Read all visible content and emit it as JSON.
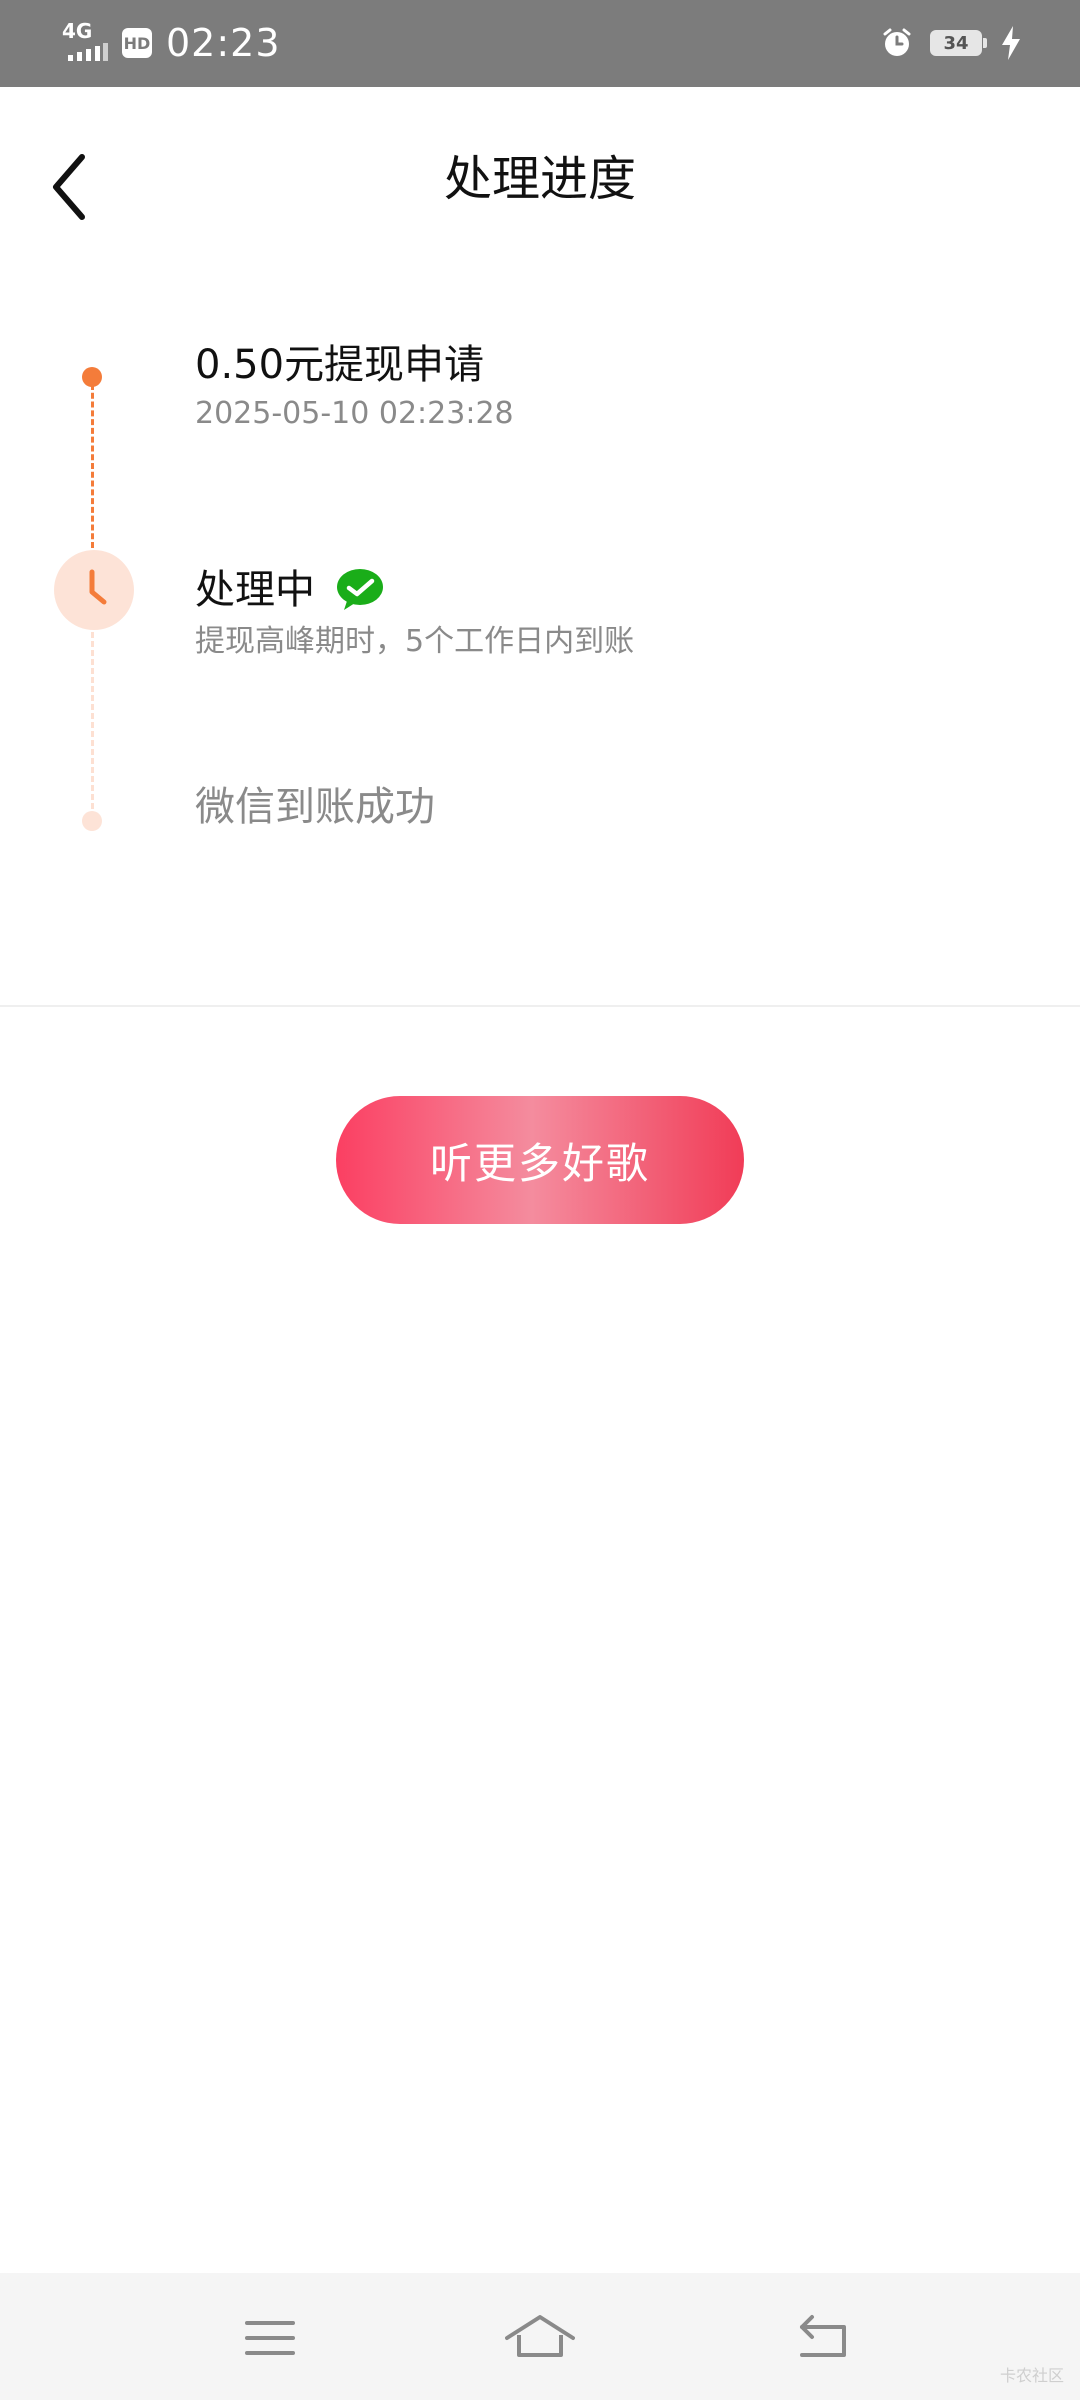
{
  "status_bar": {
    "network": "4G",
    "hd": "HD",
    "time": "02:23",
    "battery": "34",
    "icons": [
      "signal-icon",
      "hd-icon",
      "alarm-icon",
      "battery-icon",
      "charging-icon"
    ]
  },
  "header": {
    "title": "处理进度",
    "back_icon": "back-chevron-icon"
  },
  "timeline": {
    "steps": [
      {
        "title": "0.50元提现申请",
        "subtitle": "2025-05-10  02:23:28",
        "state": "done"
      },
      {
        "title": "处理中",
        "subtitle": "提现高峰期时，5个工作日内到账",
        "state": "current",
        "badge_icon": "wechat-icon"
      },
      {
        "title": "微信到账成功",
        "state": "pending"
      }
    ]
  },
  "cta": {
    "label": "听更多好歌"
  },
  "nav": {
    "icons": [
      "menu-icon",
      "home-icon",
      "back-icon"
    ]
  },
  "colors": {
    "accent_orange": "#f47c3a",
    "accent_light": "#fde3d7",
    "button_start": "#fb3f62",
    "button_end": "#f13c57",
    "wechat_green": "#1aad19"
  },
  "watermark": "卡农社区"
}
